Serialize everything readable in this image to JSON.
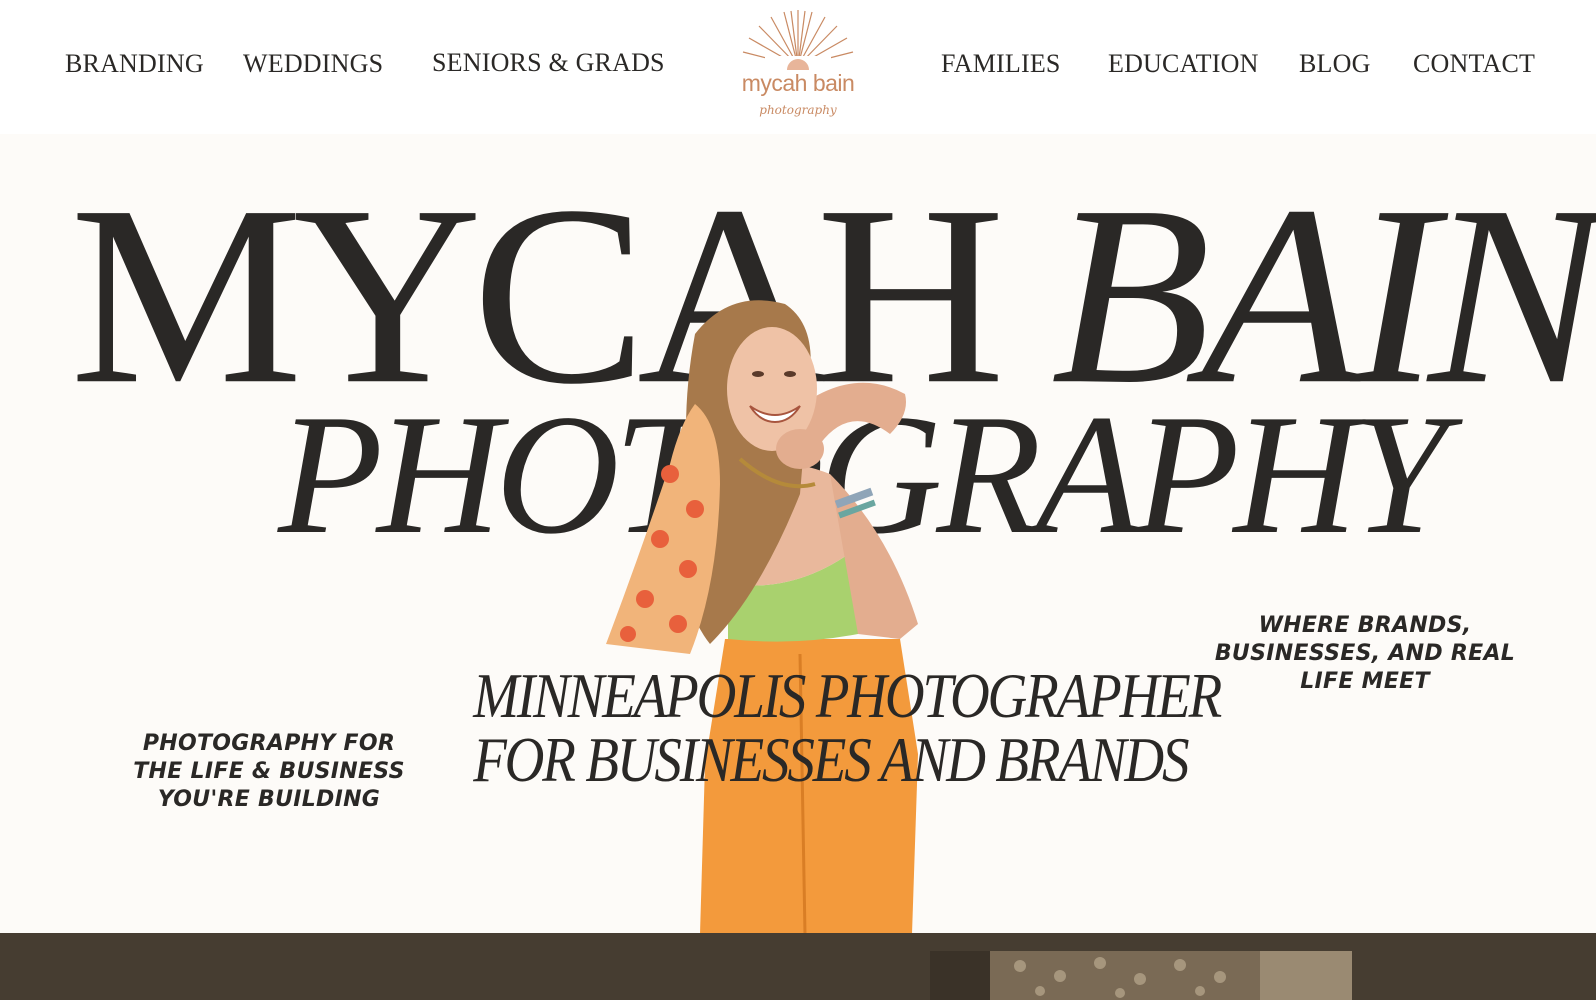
{
  "nav": {
    "left": [
      "BRANDING",
      "WEDDINGS",
      "SENIORS & GRADS"
    ],
    "right": [
      "FAMILIES",
      "EDUCATION",
      "BLOG",
      "CONTACT"
    ]
  },
  "logo": {
    "name": "mycah bain",
    "subtitle": "photography"
  },
  "hero": {
    "title_word1": "MYCAH",
    "title_word2": "BAIN",
    "title_line2": "PHOTOGRAPHY",
    "tagline_line1": "MINNEAPOLIS PHOTOGRAPHER",
    "tagline_line2": "FOR BUSINESSES AND BRANDS",
    "left_text": "PHOTOGRAPHY FOR THE LIFE & BUSINESS YOU'RE BUILDING",
    "right_text": "WHERE BRANDS, BUSINESSES, AND REAL LIFE MEET"
  },
  "colors": {
    "logo_accent": "#c98a63",
    "text": "#2a2826",
    "hero_bg": "#fdfbf8",
    "band": "#463d31"
  }
}
